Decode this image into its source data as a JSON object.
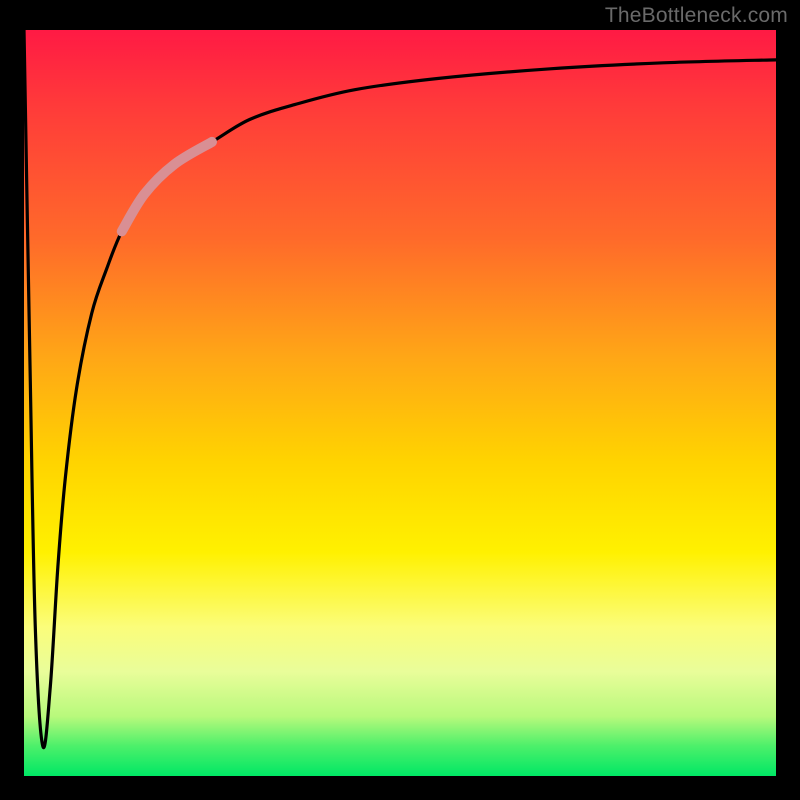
{
  "watermark": "TheBottleneck.com",
  "chart_data": {
    "type": "line",
    "title": "",
    "xlabel": "",
    "ylabel": "",
    "xlim": [
      0,
      100
    ],
    "ylim": [
      0,
      100
    ],
    "gradient_stops": [
      {
        "pos": 0,
        "color": "#ff1a44"
      },
      {
        "pos": 10,
        "color": "#ff3a3a"
      },
      {
        "pos": 28,
        "color": "#ff6a2a"
      },
      {
        "pos": 44,
        "color": "#ffa716"
      },
      {
        "pos": 58,
        "color": "#ffd400"
      },
      {
        "pos": 70,
        "color": "#fff100"
      },
      {
        "pos": 80,
        "color": "#fbfd7a"
      },
      {
        "pos": 86,
        "color": "#e9fd9a"
      },
      {
        "pos": 92,
        "color": "#b8f97c"
      },
      {
        "pos": 96,
        "color": "#4cf06a"
      },
      {
        "pos": 100,
        "color": "#00e765"
      }
    ],
    "series": [
      {
        "name": "bottleneck-curve",
        "x": [
          0.0,
          0.8,
          1.5,
          2.5,
          3.5,
          4.5,
          5.5,
          7.0,
          9.0,
          11.0,
          13.0,
          16.0,
          20.0,
          25.0,
          30.0,
          36.0,
          44.0,
          55.0,
          70.0,
          85.0,
          100.0
        ],
        "values": [
          100,
          55,
          20,
          4,
          12,
          28,
          40,
          52,
          62,
          68,
          73,
          78,
          82,
          85,
          88,
          90,
          92,
          93.5,
          94.8,
          95.6,
          96.0
        ]
      }
    ],
    "highlight_segment": {
      "series": "bottleneck-curve",
      "x_start": 16,
      "x_end": 24,
      "color": "#d98f94",
      "width": 10
    }
  }
}
